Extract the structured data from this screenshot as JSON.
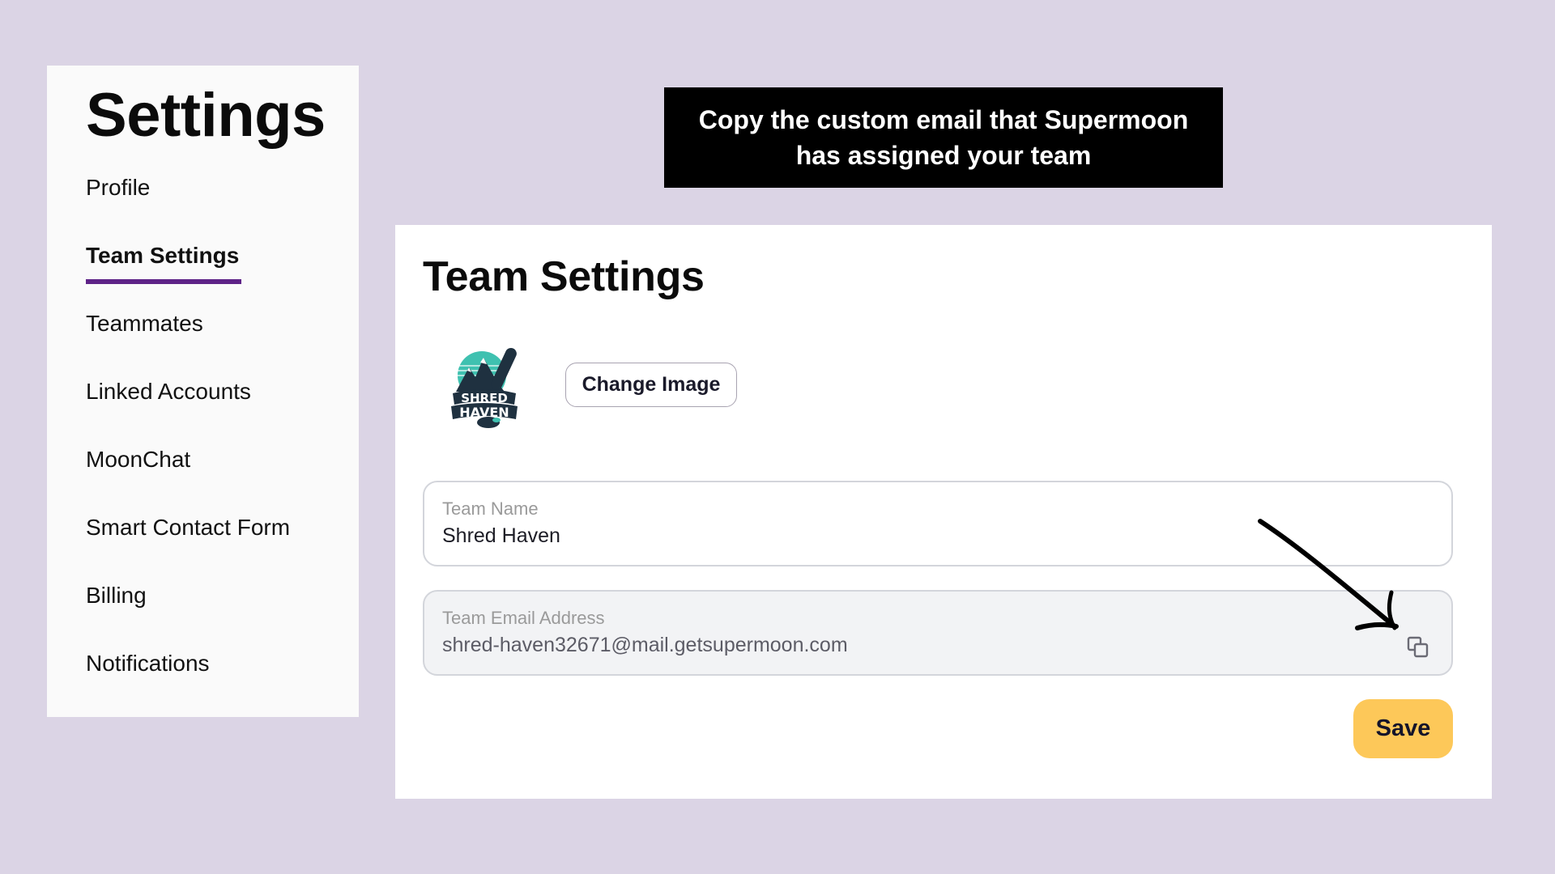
{
  "sidebar": {
    "title": "Settings",
    "items": [
      {
        "label": "Profile",
        "active": false
      },
      {
        "label": "Team Settings",
        "active": true
      },
      {
        "label": "Teammates",
        "active": false
      },
      {
        "label": "Linked Accounts",
        "active": false
      },
      {
        "label": "MoonChat",
        "active": false
      },
      {
        "label": "Smart Contact Form",
        "active": false
      },
      {
        "label": "Billing",
        "active": false
      },
      {
        "label": "Notifications",
        "active": false
      }
    ],
    "accent_color": "#5e2387"
  },
  "annotation": {
    "banner_text": "Copy the custom email that Supermoon has assigned your team",
    "arrow_target": "copy-icon"
  },
  "main": {
    "title": "Team Settings",
    "logo": {
      "alt": "Shred Haven logo",
      "text_line1": "SHRED",
      "text_line2": "HAVEN"
    },
    "change_image_label": "Change Image",
    "fields": {
      "team_name": {
        "label": "Team Name",
        "value": "Shred Haven"
      },
      "team_email": {
        "label": "Team Email Address",
        "value": "shred-haven32671@mail.getsupermoon.com",
        "icon": "copy-icon",
        "readonly": true
      }
    },
    "save_label": "Save",
    "save_color": "#fdc859"
  }
}
